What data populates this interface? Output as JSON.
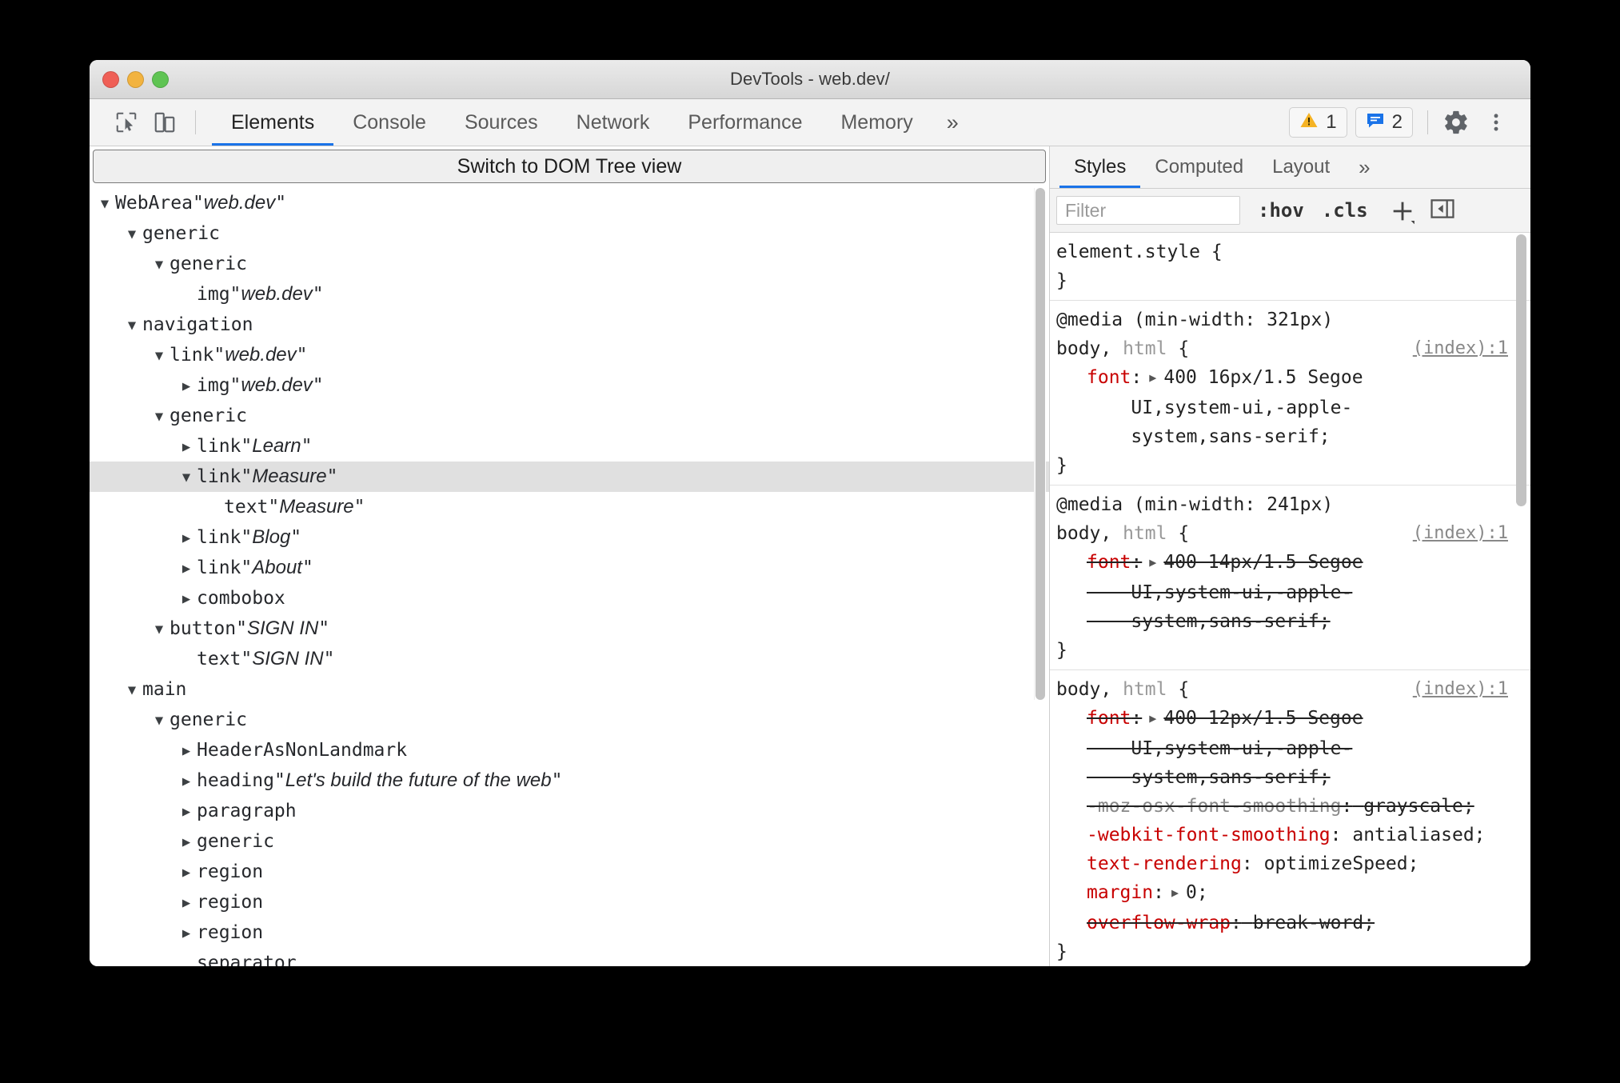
{
  "window": {
    "title": "DevTools - web.dev/",
    "traffic_lights": [
      "close",
      "minimize",
      "zoom"
    ]
  },
  "toolbar": {
    "inspect_icon": "inspect-cursor-icon",
    "device_icon": "device-toolbar-icon",
    "tabs": [
      {
        "label": "Elements",
        "active": true
      },
      {
        "label": "Console",
        "active": false
      },
      {
        "label": "Sources",
        "active": false
      },
      {
        "label": "Network",
        "active": false
      },
      {
        "label": "Performance",
        "active": false
      },
      {
        "label": "Memory",
        "active": false
      }
    ],
    "more_tabs_label": "»",
    "warning_count": "1",
    "message_count": "2",
    "settings_icon": "gear-icon",
    "menu_icon": "kebab-menu-icon"
  },
  "left_panel": {
    "switch_button_label": "Switch to DOM Tree view",
    "tree": [
      {
        "indent": 0,
        "arrow": "expanded",
        "role": "WebArea",
        "value": "web.dev",
        "selected": false
      },
      {
        "indent": 1,
        "arrow": "expanded",
        "role": "generic",
        "value": null,
        "selected": false
      },
      {
        "indent": 2,
        "arrow": "expanded",
        "role": "generic",
        "value": null,
        "selected": false
      },
      {
        "indent": 3,
        "arrow": "none",
        "role": "img",
        "value": "web.dev",
        "selected": false
      },
      {
        "indent": 1,
        "arrow": "expanded",
        "role": "navigation",
        "value": null,
        "selected": false
      },
      {
        "indent": 2,
        "arrow": "expanded",
        "role": "link",
        "value": "web.dev",
        "selected": false
      },
      {
        "indent": 3,
        "arrow": "collapsed",
        "role": "img",
        "value": "web.dev",
        "selected": false
      },
      {
        "indent": 2,
        "arrow": "expanded",
        "role": "generic",
        "value": null,
        "selected": false
      },
      {
        "indent": 3,
        "arrow": "collapsed",
        "role": "link",
        "value": "Learn",
        "selected": false
      },
      {
        "indent": 3,
        "arrow": "expanded",
        "role": "link",
        "value": "Measure",
        "selected": true
      },
      {
        "indent": 4,
        "arrow": "none",
        "role": "text",
        "value": "Measure",
        "selected": false
      },
      {
        "indent": 3,
        "arrow": "collapsed",
        "role": "link",
        "value": "Blog",
        "selected": false
      },
      {
        "indent": 3,
        "arrow": "collapsed",
        "role": "link",
        "value": "About",
        "selected": false
      },
      {
        "indent": 3,
        "arrow": "collapsed",
        "role": "combobox",
        "value": null,
        "selected": false
      },
      {
        "indent": 2,
        "arrow": "expanded",
        "role": "button",
        "value": "SIGN IN",
        "selected": false
      },
      {
        "indent": 3,
        "arrow": "none",
        "role": "text",
        "value": "SIGN IN",
        "selected": false
      },
      {
        "indent": 1,
        "arrow": "expanded",
        "role": "main",
        "value": null,
        "selected": false
      },
      {
        "indent": 2,
        "arrow": "expanded",
        "role": "generic",
        "value": null,
        "selected": false
      },
      {
        "indent": 3,
        "arrow": "collapsed",
        "role": "HeaderAsNonLandmark",
        "value": null,
        "selected": false
      },
      {
        "indent": 3,
        "arrow": "collapsed",
        "role": "heading",
        "value": "Let's build the future of the web",
        "selected": false
      },
      {
        "indent": 3,
        "arrow": "collapsed",
        "role": "paragraph",
        "value": null,
        "selected": false
      },
      {
        "indent": 3,
        "arrow": "collapsed",
        "role": "generic",
        "value": null,
        "selected": false
      },
      {
        "indent": 3,
        "arrow": "collapsed",
        "role": "region",
        "value": null,
        "selected": false
      },
      {
        "indent": 3,
        "arrow": "collapsed",
        "role": "region",
        "value": null,
        "selected": false
      },
      {
        "indent": 3,
        "arrow": "collapsed",
        "role": "region",
        "value": null,
        "selected": false
      },
      {
        "indent": 3,
        "arrow": "none",
        "role": "separator",
        "value": null,
        "selected": false
      }
    ]
  },
  "right_panel": {
    "tabs": [
      {
        "label": "Styles",
        "active": true
      },
      {
        "label": "Computed",
        "active": false
      },
      {
        "label": "Layout",
        "active": false
      }
    ],
    "more_tabs_label": "»",
    "filter_placeholder": "Filter",
    "filter_value": "",
    "hov_label": ":hov",
    "cls_label": ".cls",
    "new_rule_icon": "plus-icon",
    "toggle_sidebar_icon": "collapse-panel-icon",
    "rules": [
      {
        "selector_match": "element.style",
        "selector_dim": "",
        "media": null,
        "source": null,
        "declarations": []
      },
      {
        "media": "@media (min-width: 321px)",
        "selector_match": "body,",
        "selector_dim": "html",
        "source": "(index):1",
        "declarations": [
          {
            "property": "font",
            "value": "400 16px/1.5 Segoe UI,system-ui,-apple-system,sans-serif",
            "value_lines": [
              "400 16px/1.5 Segoe",
              "UI,system-ui,-apple-",
              "system,sans-serif;"
            ],
            "overridden": false,
            "expandable": true
          }
        ]
      },
      {
        "media": "@media (min-width: 241px)",
        "selector_match": "body,",
        "selector_dim": "html",
        "source": "(index):1",
        "declarations": [
          {
            "property": "font",
            "value": "400 14px/1.5 Segoe UI,system-ui,-apple-system,sans-serif",
            "value_lines": [
              "400 14px/1.5 Segoe",
              "UI,system-ui,-apple-",
              "system,sans-serif;"
            ],
            "overridden": true,
            "expandable": true
          }
        ]
      },
      {
        "media": null,
        "selector_match": "body,",
        "selector_dim": "html",
        "source": "(index):1",
        "declarations": [
          {
            "property": "font",
            "value": "400 12px/1.5 Segoe UI,system-ui,-apple-system,sans-serif",
            "value_lines": [
              "400 12px/1.5 Segoe",
              "UI,system-ui,-apple-",
              "system,sans-serif;"
            ],
            "overridden": true,
            "expandable": true
          },
          {
            "property": "-moz-osx-font-smoothing",
            "value": "grayscale;",
            "value_lines": [
              "grayscale;"
            ],
            "overridden": true,
            "expandable": false
          },
          {
            "property": "-webkit-font-smoothing",
            "value": "antialiased;",
            "value_lines": [
              "antialiased;"
            ],
            "overridden": false,
            "expandable": false
          },
          {
            "property": "text-rendering",
            "value": "optimizeSpeed;",
            "value_lines": [
              "optimizeSpeed;"
            ],
            "overridden": false,
            "expandable": false,
            "inline": true
          },
          {
            "property": "margin",
            "value": "0;",
            "value_lines": [
              "0;"
            ],
            "overridden": false,
            "expandable": true,
            "inline": true
          },
          {
            "property": "overflow-wrap",
            "value": "break-word;",
            "value_lines": [
              "break-word;"
            ],
            "overridden": true,
            "expandable": false,
            "inline": true
          }
        ]
      }
    ]
  }
}
